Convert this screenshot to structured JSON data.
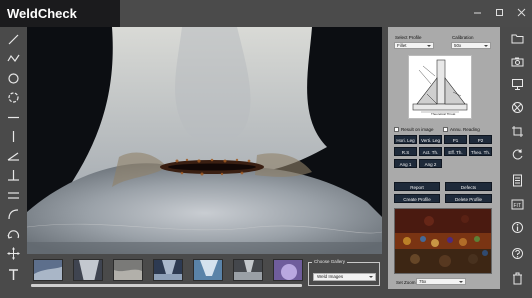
{
  "app": {
    "title": "WeldCheck"
  },
  "window_controls": [
    "minimize-icon",
    "maximize-icon",
    "close-icon"
  ],
  "left_tools": [
    "line-tool-icon",
    "polyline-tool-icon",
    "circle-tool-icon",
    "circle-dashed-tool-icon",
    "horizontal-line-tool-icon",
    "vertical-line-tool-icon",
    "angle-tool-icon",
    "perpendicular-tool-icon",
    "parallel-lines-tool-icon",
    "arc-tool-icon",
    "arc-arrow-tool-icon",
    "move-tool-icon",
    "text-tool-icon"
  ],
  "gallery": {
    "title": "Choose Gallery",
    "selected": "Weld Images"
  },
  "panel": {
    "profile_label": "Select Profile",
    "profile_value": "Fillet",
    "calibration_label": "Calibration",
    "calibration_value": "50x",
    "diagram_caption": "Theoretical Throat",
    "checkboxes": [
      {
        "label": "Result on image",
        "checked": false
      },
      {
        "label": "Annu. Reading",
        "checked": false
      }
    ],
    "measure_buttons": [
      [
        "Hori. Leg",
        "Verti. Leg",
        "P1",
        "P2"
      ],
      [
        "R.S",
        "Act. Th.",
        "Eff. Th.",
        "Theo. Th."
      ],
      [
        "Ang 1",
        "Ang 2"
      ]
    ],
    "report_button": "Report",
    "defects_button": "Defects",
    "create_profile_button": "Create Profile",
    "delete_profile_button": "Delete Profile",
    "zoom_label": "Set Zoom",
    "zoom_value": "75x"
  },
  "right_tools": [
    "folder-icon",
    "camera-icon",
    "monitor-icon",
    "aperture-icon",
    "crop-icon",
    "refresh-icon",
    "document-icon",
    "fit-icon",
    "info-icon",
    "help-icon",
    "trash-icon"
  ]
}
